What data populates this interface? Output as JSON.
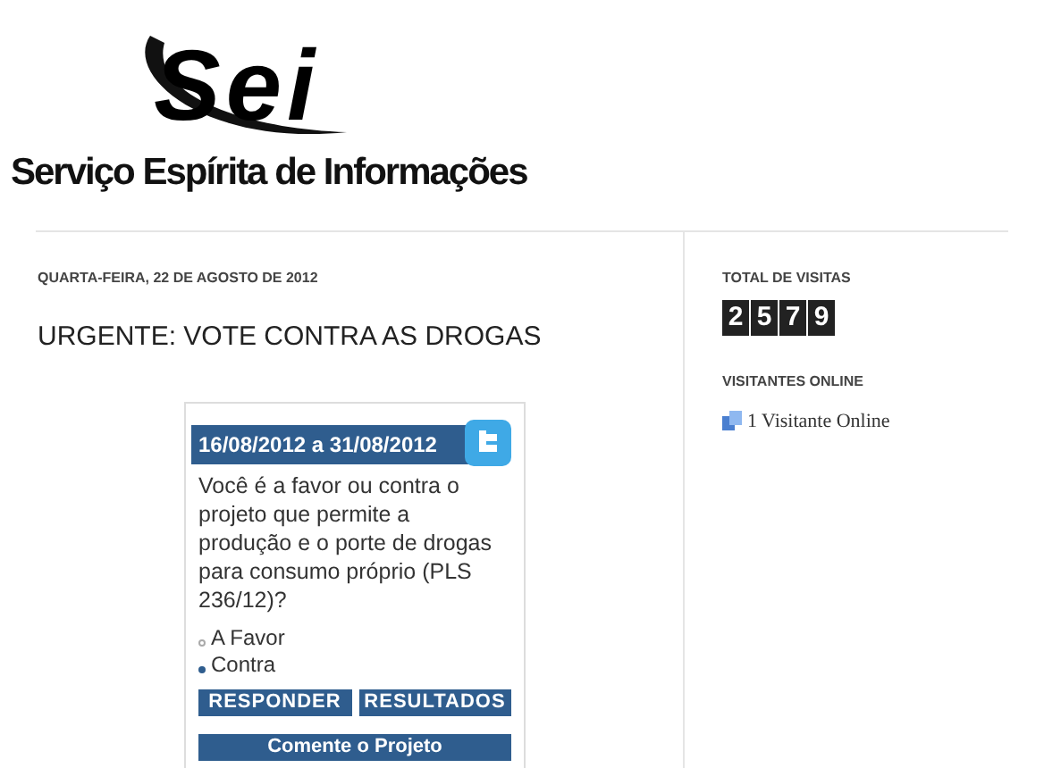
{
  "logo": {
    "mark": "Sei",
    "name": "Serviço Espírita de Informações"
  },
  "post": {
    "date": "QUARTA-FEIRA, 22 DE AGOSTO DE 2012",
    "title": "URGENTE: VOTE CONTRA AS DROGAS",
    "poll": {
      "period": "16/08/2012 a 31/08/2012",
      "question": "Você é a favor ou contra o projeto que permite a produção e o porte de drogas para consumo próprio (PLS 236/12)?",
      "options": [
        {
          "label": "A Favor",
          "selected": false
        },
        {
          "label": "Contra",
          "selected": true
        }
      ],
      "buttons": [
        "RESPONDER",
        "RESULTADOS"
      ],
      "comment_button": "Comente o Projeto"
    }
  },
  "sidebar": {
    "visits": {
      "title": "TOTAL DE VISITAS",
      "digits": [
        "2",
        "5",
        "7",
        "9"
      ]
    },
    "online": {
      "title": "VISITANTES ONLINE",
      "text": "1 Visitante Online"
    }
  }
}
